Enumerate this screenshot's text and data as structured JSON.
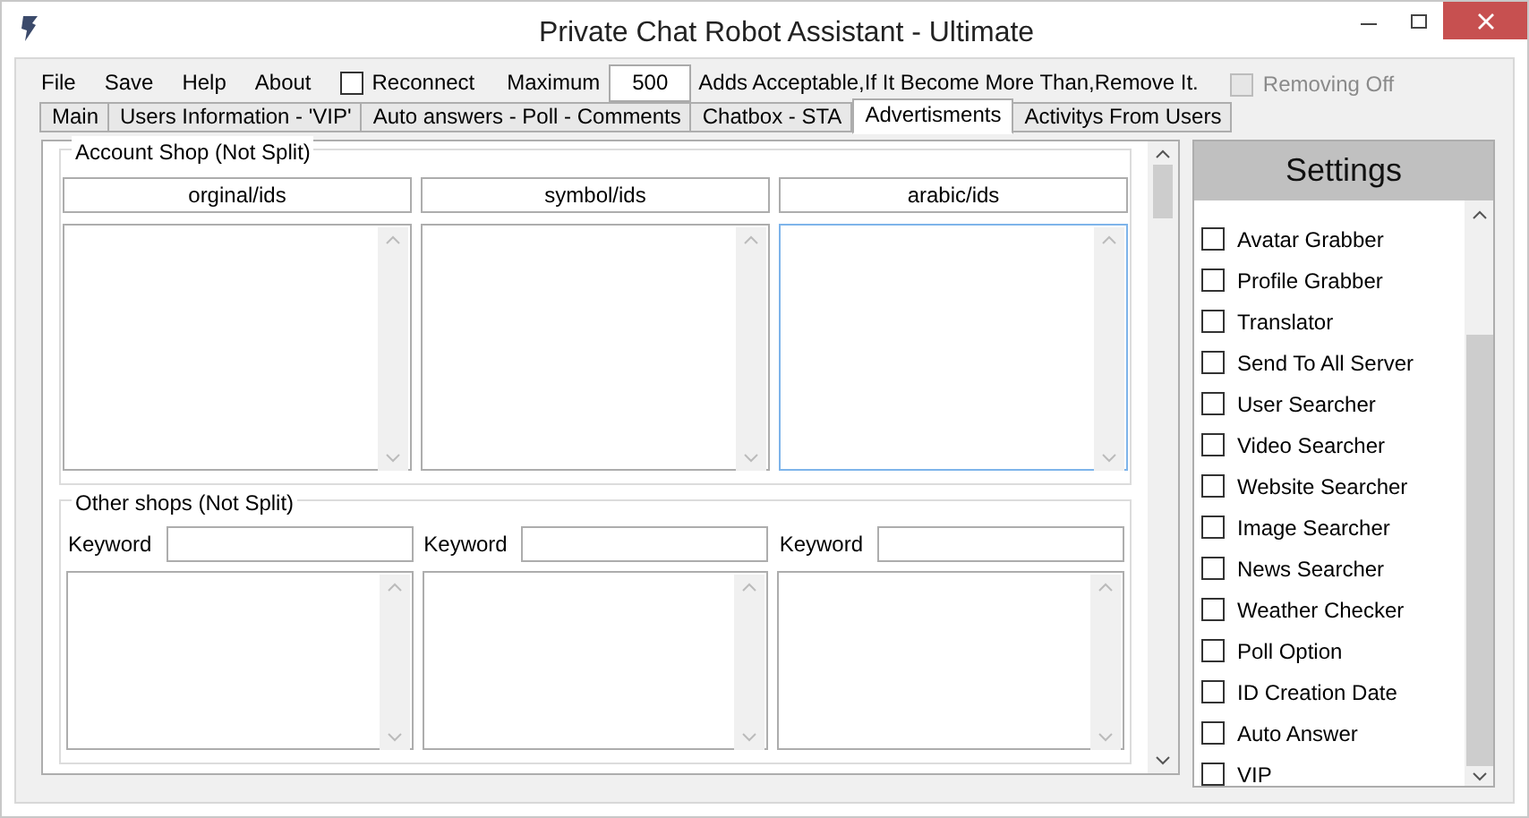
{
  "window": {
    "title": "Private Chat Robot Assistant - Ultimate"
  },
  "menu": [
    "File",
    "Save",
    "Help",
    "About"
  ],
  "reconnect": {
    "label": "Reconnect",
    "checked": false
  },
  "maximum": {
    "label": "Maximum",
    "value": "500",
    "suffix": "Adds Acceptable,If It Become More Than,Remove It."
  },
  "removing": {
    "label": "Removing Off",
    "checked": false,
    "disabled": true
  },
  "tabs": [
    {
      "label": "Main",
      "selected": false
    },
    {
      "label": "Users Information - 'VIP'",
      "selected": false
    },
    {
      "label": "Auto answers - Poll - Comments",
      "selected": false
    },
    {
      "label": "Chatbox - STA",
      "selected": false
    },
    {
      "label": "Advertisments",
      "selected": true
    },
    {
      "label": "Activitys From Users",
      "selected": false
    }
  ],
  "account_shop": {
    "title": "Account Shop (Not Split)",
    "columns": [
      {
        "header": "orginal/ids",
        "focused": false
      },
      {
        "header": "symbol/ids",
        "focused": false
      },
      {
        "header": "arabic/ids",
        "focused": true
      }
    ]
  },
  "other_shops": {
    "title": "Other shops (Not Split)",
    "columns": [
      {
        "label": "Keyword"
      },
      {
        "label": "Keyword"
      },
      {
        "label": "Keyword"
      }
    ]
  },
  "settings": {
    "title": "Settings",
    "items": [
      {
        "label": "Avatar Grabber",
        "checked": false
      },
      {
        "label": "Profile Grabber",
        "checked": false
      },
      {
        "label": "Translator",
        "checked": false
      },
      {
        "label": "Send To All Server",
        "checked": false
      },
      {
        "label": "User Searcher",
        "checked": false
      },
      {
        "label": "Video Searcher",
        "checked": false
      },
      {
        "label": "Website Searcher",
        "checked": false
      },
      {
        "label": "Image Searcher",
        "checked": false
      },
      {
        "label": "News Searcher",
        "checked": false
      },
      {
        "label": "Weather Checker",
        "checked": false
      },
      {
        "label": "Poll Option",
        "checked": false
      },
      {
        "label": "ID Creation Date",
        "checked": false
      },
      {
        "label": "Auto Answer",
        "checked": false
      },
      {
        "label": "VIP",
        "checked": false
      }
    ]
  }
}
